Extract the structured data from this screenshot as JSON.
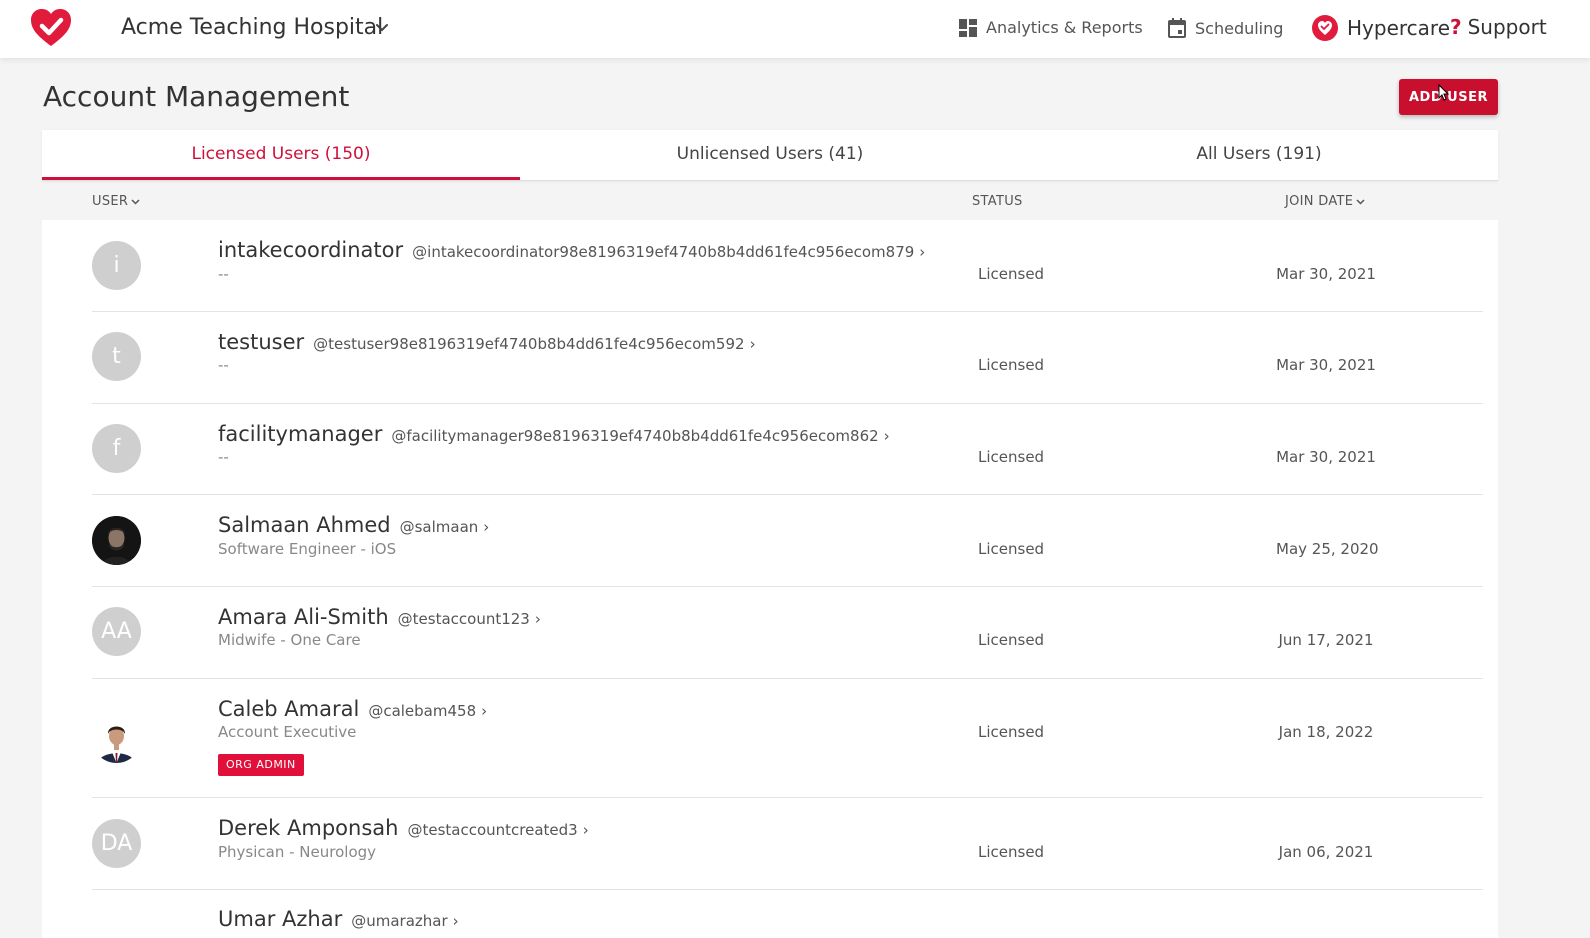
{
  "header": {
    "org_name": "Acme Teaching Hospital",
    "nav": {
      "analytics": "Analytics & Reports",
      "scheduling": "Scheduling",
      "hypercare": "Hypercare",
      "support_mark": "?",
      "support": "Support"
    }
  },
  "page": {
    "title": "Account Management",
    "add_user_label": "ADD USER"
  },
  "tabs": [
    {
      "label": "Licensed Users (150)",
      "active": true
    },
    {
      "label": "Unlicensed Users (41)",
      "active": false
    },
    {
      "label": "All Users (191)",
      "active": false
    }
  ],
  "columns": {
    "user": "USER",
    "status": "STATUS",
    "join_date": "JOIN DATE"
  },
  "users": [
    {
      "initials": "i",
      "name": "intakecoordinator",
      "handle": "@intakecoordinator98e8196319ef4740b8b4dd61fe4c956ecom879",
      "subtitle": "--",
      "status": "Licensed",
      "join_date": "Mar 30, 2021"
    },
    {
      "initials": "t",
      "name": "testuser",
      "handle": "@testuser98e8196319ef4740b8b4dd61fe4c956ecom592",
      "subtitle": "--",
      "status": "Licensed",
      "join_date": "Mar 30, 2021"
    },
    {
      "initials": "f",
      "name": "facilitymanager",
      "handle": "@facilitymanager98e8196319ef4740b8b4dd61fe4c956ecom862",
      "subtitle": "--",
      "status": "Licensed",
      "join_date": "Mar 30, 2021"
    },
    {
      "initials": "",
      "name": "Salmaan Ahmed",
      "handle": "@salmaan",
      "subtitle": "Software Engineer - iOS",
      "status": "Licensed",
      "join_date": "May 25, 2020"
    },
    {
      "initials": "AA",
      "name": "Amara Ali-Smith",
      "handle": "@testaccount123",
      "subtitle": "Midwife - One Care",
      "status": "Licensed",
      "join_date": "Jun 17, 2021"
    },
    {
      "initials": "",
      "name": "Caleb Amaral",
      "handle": "@calebam458",
      "subtitle": "Account Executive",
      "badge": "ORG ADMIN",
      "status": "Licensed",
      "join_date": "Jan 18, 2022"
    },
    {
      "initials": "DA",
      "name": "Derek Amponsah",
      "handle": "@testaccountcreated3",
      "subtitle": "Physican - Neurology",
      "status": "Licensed",
      "join_date": "Jan 06, 2021"
    },
    {
      "initials": "",
      "name": "Umar Azhar",
      "handle": "@umarazhar",
      "subtitle": "",
      "status": "",
      "join_date": ""
    }
  ],
  "chevron_glyph": "›",
  "colors": {
    "accent": "#d0103a",
    "button": "#c8102e",
    "avatar_gray": "#cfcfcf"
  }
}
